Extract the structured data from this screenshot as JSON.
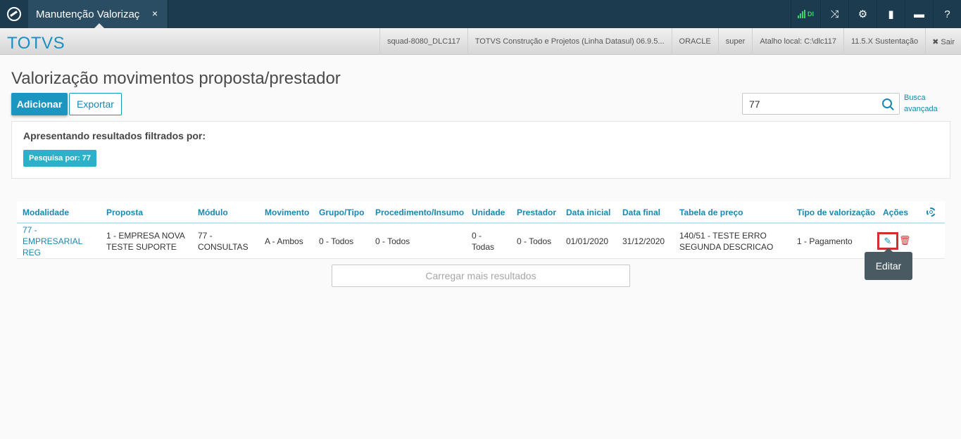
{
  "topbar": {
    "tab_label": "Manutenção Valorizaç",
    "tab_close": "×",
    "signal_label": "DI"
  },
  "infobar": {
    "brand": "TOTVS",
    "items": [
      "squad-8080_DLC117",
      "TOTVS Construção e Projetos (Linha Datasul) 06.9.5...",
      "ORACLE",
      "super",
      "Atalho local: C:\\dlc117",
      "11.5.X Sustentação"
    ],
    "logout": "✖ Sair"
  },
  "page": {
    "title": "Valorização movimentos proposta/prestador",
    "add_label": "Adicionar",
    "export_label": "Exportar",
    "search_value": "77",
    "advanced_search": "Busca avançada"
  },
  "filter": {
    "title": "Apresentando resultados filtrados por:",
    "tag": "Pesquisa por: 77"
  },
  "table": {
    "headers": [
      "Modalidade",
      "Proposta",
      "Módulo",
      "Movimento",
      "Grupo/Tipo",
      "Procedimento/Insumo",
      "Unidade",
      "Prestador",
      "Data inicial",
      "Data final",
      "Tabela de preço",
      "Tipo de valorização",
      "Ações"
    ],
    "rows": [
      {
        "modalidade": "77 - EMPRESARIAL REG",
        "proposta": "1 - EMPRESA NOVA TESTE SUPORTE",
        "modulo": "77 - CONSULTAS",
        "movimento": "A - Ambos",
        "grupo": "0 - Todos",
        "procedimento": "0 - Todos",
        "unidade": "0 - Todas",
        "prestador": "0 - Todos",
        "data_inicial": "01/01/2020",
        "data_final": "31/12/2020",
        "tabela": "140/51 - TESTE ERRO SEGUNDA DESCRICAO",
        "tipo": "1 - Pagamento"
      }
    ]
  },
  "tooltip": "Editar",
  "load_more": "Carregar mais resultados",
  "colors": {
    "topbar": "#1c3b4f",
    "accent": "#1a96c0",
    "link": "#1a87b0",
    "tag": "#2db1c8",
    "danger": "#d32f2f"
  }
}
